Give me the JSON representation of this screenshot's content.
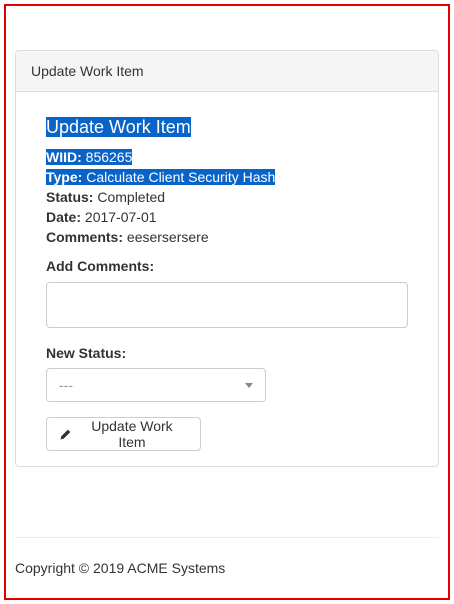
{
  "panel": {
    "heading": "Update Work Item"
  },
  "work_item": {
    "title": "Update Work Item",
    "wiid_label": "WIID:",
    "wiid_value": "856265",
    "type_label": "Type:",
    "type_value": "Calculate Client Security Hash",
    "status_label": "Status:",
    "status_value": "Completed",
    "date_label": "Date:",
    "date_value": "2017-07-01",
    "comments_label": "Comments:",
    "comments_value": "eesersersere"
  },
  "form": {
    "add_comments_label": "Add Comments:",
    "add_comments_value": "",
    "new_status_label": "New Status:",
    "new_status_selected": "---",
    "update_button_label": "Update Work Item",
    "update_button_icon": "pencil-icon"
  },
  "footer": {
    "copyright": "Copyright © 2019 ACME Systems"
  },
  "colors": {
    "selection": "#0a64c8",
    "frame_border": "#e00000",
    "panel_heading_bg": "#f5f5f5"
  }
}
